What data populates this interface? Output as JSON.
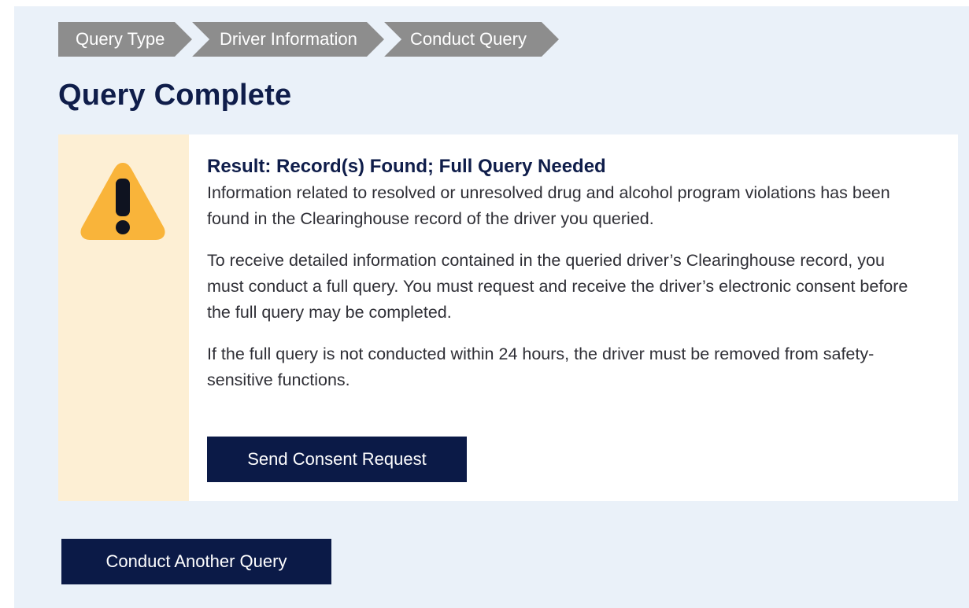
{
  "breadcrumb": {
    "steps": [
      {
        "label": "Query Type"
      },
      {
        "label": "Driver Information"
      },
      {
        "label": "Conduct Query"
      }
    ]
  },
  "page_title": "Query Complete",
  "alert": {
    "icon": "warning-triangle-icon",
    "heading": "Result: Record(s) Found; Full Query Needed",
    "paragraphs": [
      "Information related to resolved or unresolved drug and alcohol program violations has been found in the Clearinghouse record of the driver you queried.",
      "To receive detailed information contained in the queried driver’s Clearinghouse record, you must conduct a full query. You must request and receive the driver’s electronic consent before the full query may be completed.",
      "If the full query is not conducted within 24 hours, the driver must be removed from safety-sensitive functions."
    ],
    "send_button_label": "Send Consent Request"
  },
  "conduct_another_label": "Conduct Another Query",
  "colors": {
    "page_bg": "#eaf1f9",
    "breadcrumb_bg": "#8d8d8d",
    "title": "#0f1d4a",
    "button_bg": "#0b1a47",
    "alert_side_bg": "#fdefd4",
    "warning": "#f9b43a"
  }
}
